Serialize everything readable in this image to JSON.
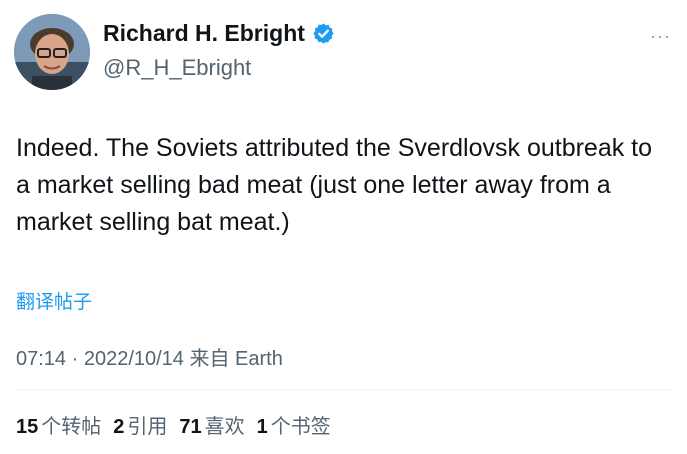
{
  "tweet": {
    "author": {
      "display_name": "Richard H. Ebright",
      "handle": "@R_H_Ebright",
      "verified_icon": "verified-badge-icon",
      "verified_color": "#1d9bf0"
    },
    "more_label": "···",
    "text": "Indeed. The Soviets attributed the Sverdlovsk outbreak to a market selling bad meat (just one letter away from a market selling bat meat.)",
    "translate_label": "翻译帖子",
    "timestamp": "07:14 · 2022/10/14 来自 Earth",
    "stats": [
      {
        "count": "15",
        "label": "个转帖"
      },
      {
        "count": "2",
        "label": "引用"
      },
      {
        "count": "71",
        "label": "喜欢"
      },
      {
        "count": "1",
        "label": "个书签"
      }
    ]
  },
  "colors": {
    "accent": "#1d9bf0",
    "text_primary": "#0f1419",
    "text_secondary": "#536471"
  }
}
